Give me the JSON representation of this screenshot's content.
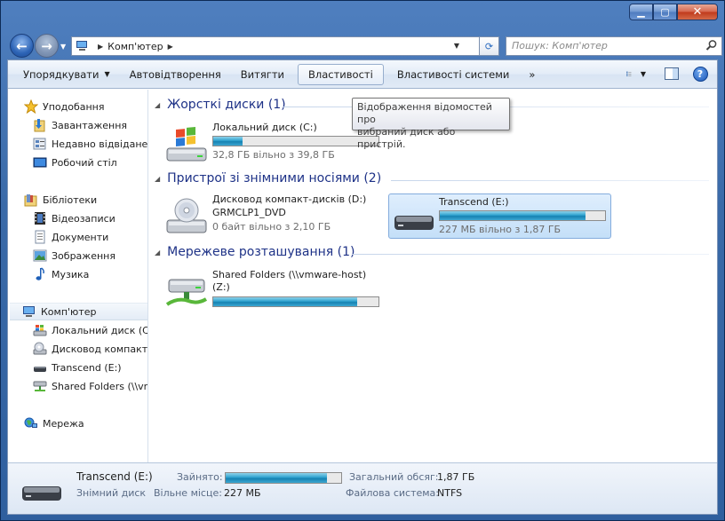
{
  "window": {
    "caption_buttons": [
      "minimize",
      "maximize",
      "close"
    ]
  },
  "nav": {
    "address_root": "Комп'ютер",
    "search_placeholder": "Пошук: Комп'ютер"
  },
  "toolbar": {
    "organize": "Упорядкувати",
    "autoplay": "Автовідтворення",
    "eject": "Витягти",
    "properties": "Властивості",
    "system_properties": "Властивості системи",
    "more": "»"
  },
  "sidebar": {
    "favorites": "Уподобання",
    "downloads": "Завантаження",
    "recent": "Недавно відвідане",
    "desktop": "Робочий стіл",
    "libraries": "Бібліотеки",
    "videos": "Відеозаписи",
    "documents": "Документи",
    "pictures": "Зображення",
    "music": "Музика",
    "computer": "Комп'ютер",
    "local_disk": "Локальний диск (C:",
    "cd_drive": "Дисковод компакт-",
    "transcend": "Transcend (E:)",
    "shared": "Shared Folders (\\\\vn",
    "network": "Мережа"
  },
  "groups": {
    "hard": "Жорсткі диски (1)",
    "removable": "Пристрої зі знімними носіями (2)",
    "network": "Мережеве розташування (1)"
  },
  "drives": {
    "c": {
      "name": "Локальний диск (C:)",
      "free": "32,8 ГБ вільно з 39,8 ГБ",
      "used_fraction": 0.18
    },
    "d": {
      "name": "Дисковод компакт-дисків (D:)",
      "label": "GRMCLP1_DVD",
      "free": "0 байт вільно з 2,10 ГБ"
    },
    "e": {
      "name": "Transcend (E:)",
      "free": "227 МБ вільно з 1,87 ГБ",
      "used_fraction": 0.88
    },
    "z": {
      "name": "Shared Folders (\\\\vmware-host)",
      "name2": "(Z:)",
      "used_fraction": 0.87
    }
  },
  "tooltip": {
    "line1": "Відображення відомостей про",
    "line2": "вибраний диск або пристрій."
  },
  "details": {
    "name": "Transcend (E:)",
    "type": "Знімний диск",
    "used_label": "Зайнято:",
    "used_fraction": 0.88,
    "free_label": "Вільне місце:",
    "free_value": "227 МБ",
    "total_label": "Загальний обсяг:",
    "total_value": "1,87 ГБ",
    "fs_label": "Файлова система:",
    "fs_value": "NTFS"
  }
}
